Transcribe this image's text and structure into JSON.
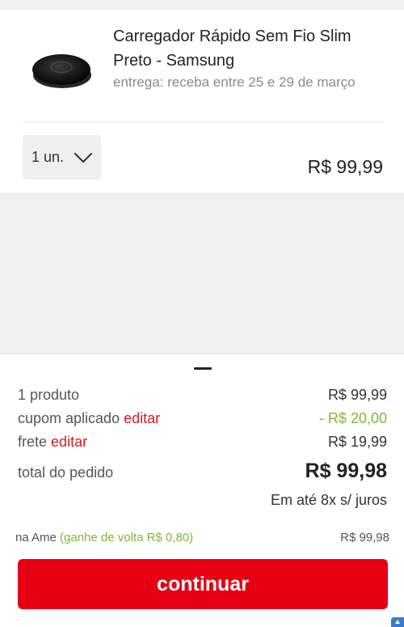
{
  "product": {
    "name": "Carregador Rápido Sem Fio Slim Preto - Samsung",
    "delivery": "entrega: receba entre 25 e 29 de março",
    "quantity": "1 un.",
    "price": "R$ 99,99"
  },
  "summary": {
    "products_label": "1 produto",
    "products_value": "R$ 99,99",
    "coupon_label": "cupom aplicado",
    "coupon_edit": "editar",
    "coupon_value": "- R$ 20,00",
    "shipping_label": "frete",
    "shipping_edit": "editar",
    "shipping_value": "R$ 19,99",
    "total_label": "total do pedido",
    "total_value": "R$ 99,98",
    "installments": "Em até 8x s/ juros",
    "ame_label": "na Ame",
    "ame_cashback": "(ganhe de volta R$ 0,80)",
    "ame_value": "R$ 99,98"
  },
  "cta": {
    "label": "continuar"
  },
  "colors": {
    "brand_red": "#e60014",
    "link_red": "#cc1d22",
    "discount_green": "#7db734"
  },
  "icons": [
    "chevron-down-icon",
    "wireless-charger-image",
    "app-badge-icon"
  ]
}
